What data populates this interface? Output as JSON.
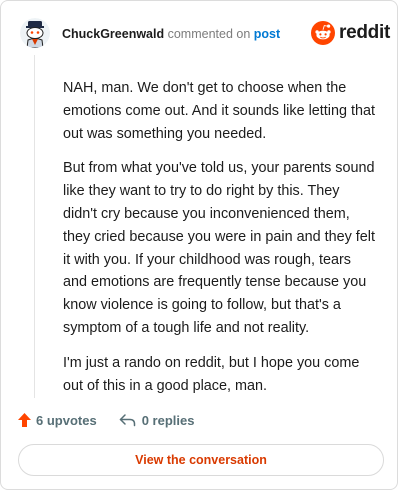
{
  "header": {
    "username": "ChuckGreenwald",
    "action_text": "commented on",
    "post_link": "post",
    "brand_word": "reddit",
    "avatar_icon": "snoo-avatar-icon",
    "brand_icon": "reddit-logo-icon"
  },
  "comment": {
    "paragraphs": [
      "NAH, man. We don't get to choose when the emotions come out. And it sounds like letting that out was something you needed.",
      "But from what you've told us, your parents sound like they want to try to do right by this. They didn't cry because you inconvenienced them, they cried because you were in pain and they felt it with you. If your childhood was rough, tears and emotions are frequently tense because you know violence is going to follow, but that's a symptom of a tough life and not reality.",
      "I'm just a rando on reddit, but I hope you come out of this in a good place, man."
    ]
  },
  "actions": {
    "upvotes_label": "6 upvotes",
    "replies_label": "0 replies",
    "upvote_icon": "upvote-arrow-icon",
    "reply_icon": "reply-arrow-icon"
  },
  "footer": {
    "button_label": "View the conversation"
  },
  "colors": {
    "brand_orange": "#ff4500",
    "link_blue": "#0079d3",
    "button_text": "#d93a00",
    "meta_gray": "#576f76"
  }
}
